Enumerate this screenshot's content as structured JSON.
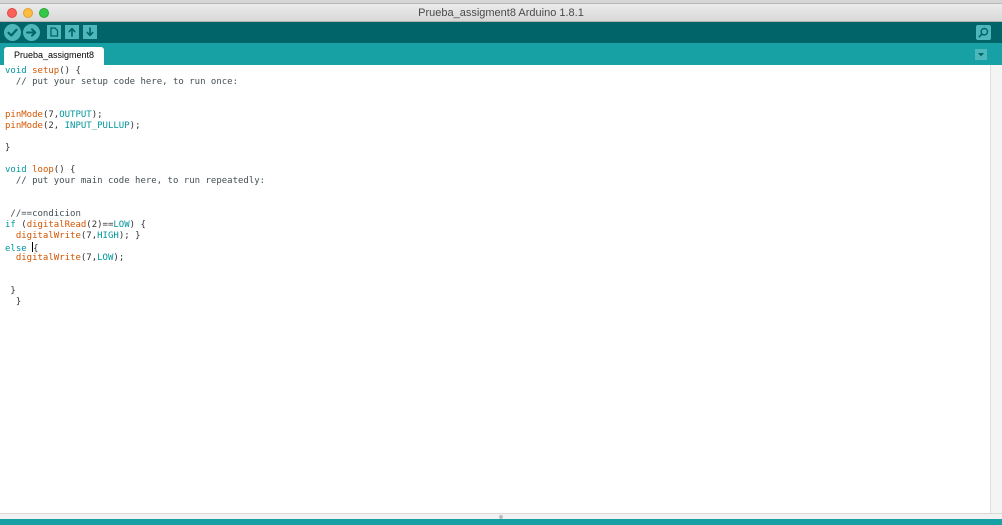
{
  "window": {
    "title": "Prueba_assigment8 Arduino 1.8.1"
  },
  "toolbar": {
    "buttons": [
      {
        "name": "verify",
        "icon": "check-icon"
      },
      {
        "name": "upload",
        "icon": "arrow-right-icon"
      },
      {
        "name": "new",
        "icon": "new-file-icon"
      },
      {
        "name": "open",
        "icon": "arrow-up-icon"
      },
      {
        "name": "save",
        "icon": "arrow-down-icon"
      }
    ],
    "serial_monitor_icon": "magnifier-icon"
  },
  "tabs": [
    {
      "label": "Prueba_assigment8"
    }
  ],
  "colors": {
    "toolbar": "#006468",
    "tabbar": "#17a1a5",
    "button": "#4db7bb",
    "keyword": "#00979c",
    "function": "#d35400"
  },
  "editor": {
    "lines": [
      [
        {
          "t": "void",
          "c": "kw-type"
        },
        {
          "t": " "
        },
        {
          "t": "setup",
          "c": "kw-fn"
        },
        {
          "t": "() {"
        }
      ],
      [
        {
          "t": "  // put your setup code here, to run once:",
          "c": "cmt"
        }
      ],
      [],
      [],
      [
        {
          "t": "pinMode",
          "c": "kw-fn"
        },
        {
          "t": "(7,"
        },
        {
          "t": "OUTPUT",
          "c": "kw-const"
        },
        {
          "t": ");"
        }
      ],
      [
        {
          "t": "pinMode",
          "c": "kw-fn"
        },
        {
          "t": "(2, "
        },
        {
          "t": "INPUT_PULLUP",
          "c": "kw-const"
        },
        {
          "t": ");"
        }
      ],
      [],
      [
        {
          "t": "}"
        }
      ],
      [],
      [
        {
          "t": "void",
          "c": "kw-type"
        },
        {
          "t": " "
        },
        {
          "t": "loop",
          "c": "kw-fn"
        },
        {
          "t": "() {"
        }
      ],
      [
        {
          "t": "  // put your main code here, to run repeatedly:",
          "c": "cmt"
        }
      ],
      [],
      [],
      [
        {
          "t": " //==condicion",
          "c": "cmt"
        }
      ],
      [
        {
          "t": "if",
          "c": "kw-type"
        },
        {
          "t": " ("
        },
        {
          "t": "digitalRead",
          "c": "kw-fn"
        },
        {
          "t": "(2)=="
        },
        {
          "t": "LOW",
          "c": "kw-const"
        },
        {
          "t": ") {"
        }
      ],
      [
        {
          "t": "  "
        },
        {
          "t": "digitalWrite",
          "c": "kw-fn"
        },
        {
          "t": "(7,"
        },
        {
          "t": "HIGH",
          "c": "kw-const"
        },
        {
          "t": "); }"
        }
      ],
      [
        {
          "t": "else",
          "c": "kw-type"
        },
        {
          "t": " "
        },
        {
          "t": "",
          "c": "caret"
        },
        {
          "t": "{"
        }
      ],
      [
        {
          "t": "  "
        },
        {
          "t": "digitalWrite",
          "c": "kw-fn"
        },
        {
          "t": "(7,"
        },
        {
          "t": "LOW",
          "c": "kw-const"
        },
        {
          "t": ");"
        }
      ],
      [],
      [],
      [
        {
          "t": " }"
        }
      ],
      [
        {
          "t": "  }"
        }
      ]
    ]
  }
}
